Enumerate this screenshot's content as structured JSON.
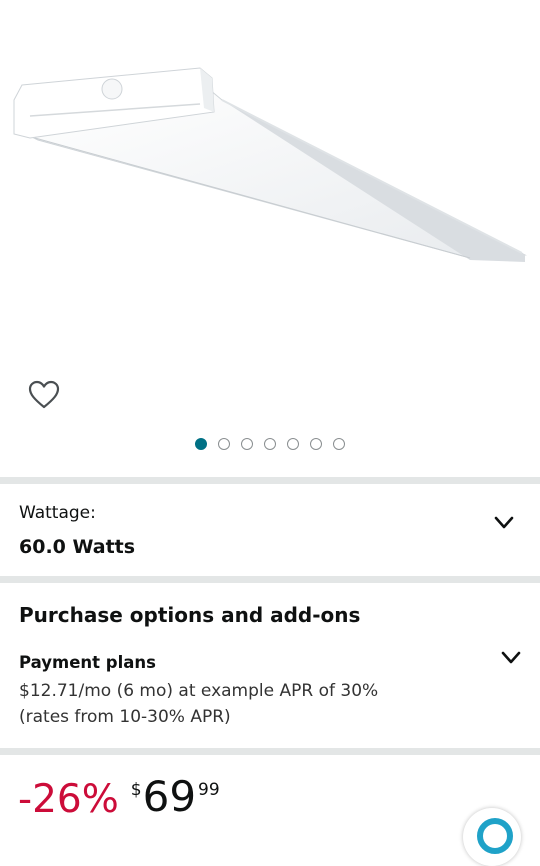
{
  "gallery": {
    "product_image": "led-wraparound-ceiling-light",
    "image_count": 7,
    "active_index": 0,
    "accent_color": "#007185"
  },
  "variation": {
    "label": "Wattage:",
    "value": "60.0 Watts"
  },
  "purchase_options": {
    "heading": "Purchase options and add-ons",
    "payment_plans_title": "Payment plans",
    "payment_line1": "$12.71/mo (6 mo) at example APR of 30%",
    "payment_line2": "(rates from 10-30% APR)"
  },
  "price": {
    "discount": "-26%",
    "currency": "$",
    "whole": "69",
    "fraction": "99",
    "discount_color": "#cc0c39"
  },
  "icons": {
    "wishlist": "heart-outline-icon",
    "expand": "chevron-down-icon",
    "assistant": "rufus-assistant-icon"
  }
}
